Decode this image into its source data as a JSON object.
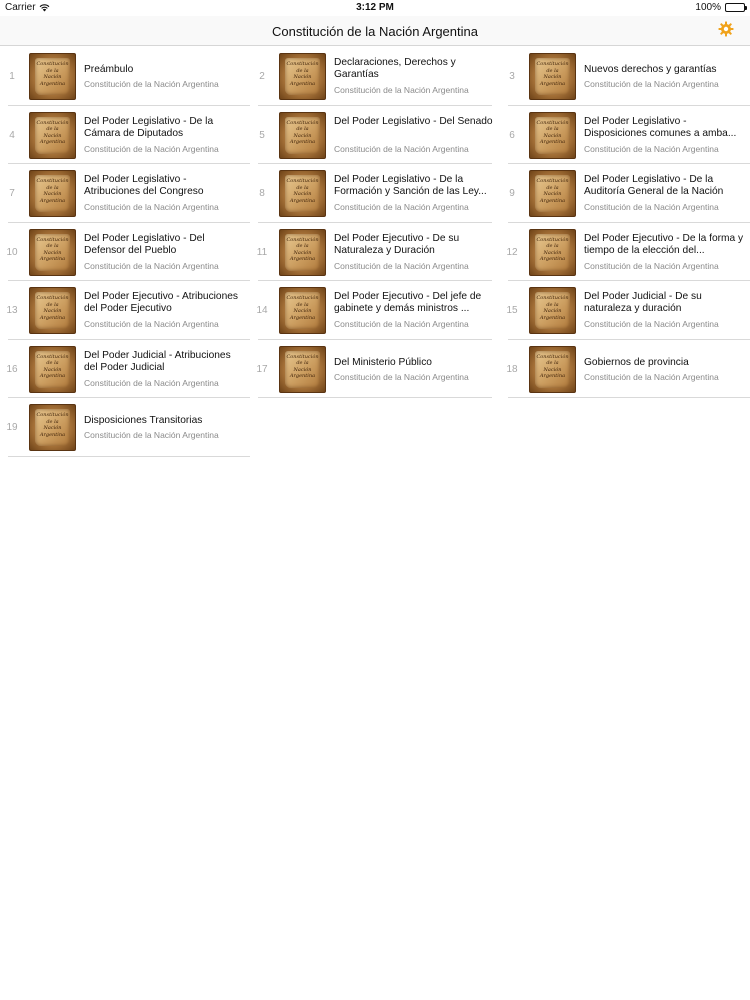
{
  "status_bar": {
    "carrier": "Carrier",
    "time": "3:12 PM",
    "battery": "100%"
  },
  "nav": {
    "title": "Constitución de la Nación Argentina",
    "settings_icon": "gear-icon",
    "accent_color": "#f0a21b"
  },
  "thumbnail_text": "Constitución\nde la\nNación\nArgentina",
  "chapters": [
    {
      "num": "1",
      "title": "Preámbulo",
      "subtitle": "Constitución de la Nación Argentina",
      "lines": 1
    },
    {
      "num": "2",
      "title": "Declaraciones, Derechos y Garantías",
      "subtitle": "Constitución de la Nación Argentina",
      "lines": 2
    },
    {
      "num": "3",
      "title": "Nuevos derechos y garantías",
      "subtitle": "Constitución de la Nación Argentina",
      "lines": 1
    },
    {
      "num": "4",
      "title": "Del Poder Legislativo - De la Cámara de Diputados",
      "subtitle": "Constitución de la Nación Argentina",
      "lines": 2
    },
    {
      "num": "5",
      "title": "Del Poder Legislativo - Del Senado",
      "subtitle": "Constitución de la Nación Argentina",
      "lines": 2
    },
    {
      "num": "6",
      "title": "Del Poder Legislativo - Disposiciones comunes a amba...",
      "subtitle": "Constitución de la Nación Argentina",
      "lines": 2
    },
    {
      "num": "7",
      "title": "Del Poder Legislativo - Atribuciones del Congreso",
      "subtitle": "Constitución de la Nación Argentina",
      "lines": 2
    },
    {
      "num": "8",
      "title": "Del Poder Legislativo - De la Formación y Sanción de las Ley...",
      "subtitle": "Constitución de la Nación Argentina",
      "lines": 2
    },
    {
      "num": "9",
      "title": "Del Poder Legislativo - De la Auditoría General de la Nación",
      "subtitle": "Constitución de la Nación Argentina",
      "lines": 2
    },
    {
      "num": "10",
      "title": "Del Poder Legislativo - Del Defensor del Pueblo",
      "subtitle": "Constitución de la Nación Argentina",
      "lines": 2
    },
    {
      "num": "11",
      "title": "Del Poder Ejecutivo - De su Naturaleza y Duración",
      "subtitle": "Constitución de la Nación Argentina",
      "lines": 2
    },
    {
      "num": "12",
      "title": "Del Poder Ejecutivo - De la forma y tiempo de la elección del...",
      "subtitle": "Constitución de la Nación Argentina",
      "lines": 2
    },
    {
      "num": "13",
      "title": "Del Poder Ejecutivo - Atribuciones del Poder Ejecutivo",
      "subtitle": "Constitución de la Nación Argentina",
      "lines": 2
    },
    {
      "num": "14",
      "title": "Del Poder Ejecutivo - Del jefe de gabinete y demás ministros ...",
      "subtitle": "Constitución de la Nación Argentina",
      "lines": 2
    },
    {
      "num": "15",
      "title": "Del Poder Judicial - De su naturaleza y duración",
      "subtitle": "Constitución de la Nación Argentina",
      "lines": 2
    },
    {
      "num": "16",
      "title": "Del Poder Judicial - Atribuciones del Poder Judicial",
      "subtitle": "Constitución de la Nación Argentina",
      "lines": 2
    },
    {
      "num": "17",
      "title": "Del Ministerio Público",
      "subtitle": "Constitución de la Nación Argentina",
      "lines": 1
    },
    {
      "num": "18",
      "title": "Gobiernos de provincia",
      "subtitle": "Constitución de la Nación Argentina",
      "lines": 1
    },
    {
      "num": "19",
      "title": "Disposiciones Transitorias",
      "subtitle": "Constitución de la Nación Argentina",
      "lines": 1
    }
  ]
}
